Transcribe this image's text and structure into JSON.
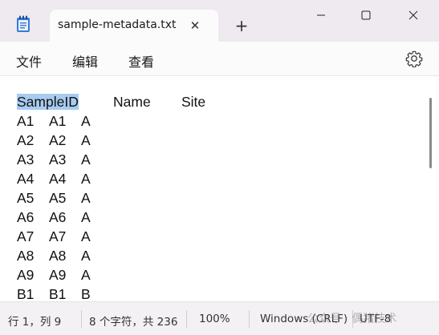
{
  "tab": {
    "title": "sample-metadata.txt",
    "close_glyph": "✕",
    "new_tab_glyph": "+"
  },
  "menu": {
    "file": "文件",
    "edit": "编辑",
    "view": "查看"
  },
  "editor": {
    "header": {
      "c1": "SampleID",
      "c2": "Name",
      "c3": "Site"
    },
    "rows": [
      [
        "A1",
        "A1",
        "A"
      ],
      [
        "A2",
        "A2",
        "A"
      ],
      [
        "A3",
        "A3",
        "A"
      ],
      [
        "A4",
        "A4",
        "A"
      ],
      [
        "A5",
        "A5",
        "A"
      ],
      [
        "A6",
        "A6",
        "A"
      ],
      [
        "A7",
        "A7",
        "A"
      ],
      [
        "A8",
        "A8",
        "A"
      ],
      [
        "A9",
        "A9",
        "A"
      ],
      [
        "B1",
        "B1",
        "B"
      ]
    ]
  },
  "status": {
    "position": "行 1，列 9",
    "char_count": "8 个字符，共 236",
    "zoom": "100%",
    "line_ending": "Windows (CRLF)",
    "encoding": "UTF-8"
  },
  "watermark": "公众号 · 偶猪技术",
  "colors": {
    "selection": "#a8cbf0",
    "titlebar": "#eeeaf0",
    "editor_bg": "#ffffff"
  },
  "icons": {
    "app": "notepad-icon",
    "close_tab": "close-icon",
    "new_tab": "plus-icon",
    "minimize": "minimize-icon",
    "maximize": "maximize-icon",
    "close_window": "close-icon",
    "settings": "gear-icon"
  }
}
